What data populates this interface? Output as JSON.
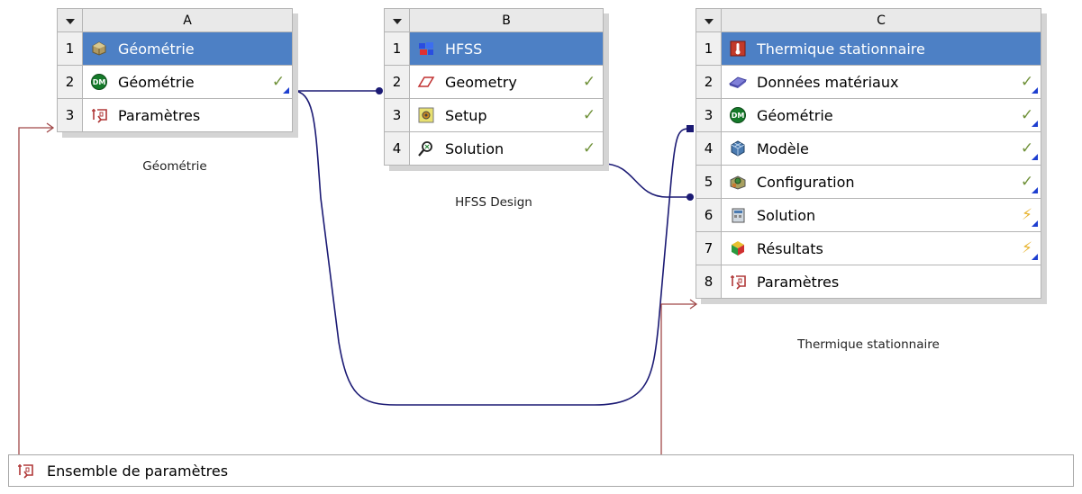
{
  "systems": {
    "a": {
      "letter": "A",
      "rows": [
        {
          "num": "1",
          "label": "Géométrie"
        },
        {
          "num": "2",
          "label": "Géométrie",
          "status": "✓"
        },
        {
          "num": "3",
          "label": "Paramètres"
        }
      ],
      "caption": "Géométrie"
    },
    "b": {
      "letter": "B",
      "rows": [
        {
          "num": "1",
          "label": "HFSS"
        },
        {
          "num": "2",
          "label": "Geometry",
          "status": "✓"
        },
        {
          "num": "3",
          "label": "Setup",
          "status": "✓"
        },
        {
          "num": "4",
          "label": "Solution",
          "status": "✓"
        }
      ],
      "caption": "HFSS Design"
    },
    "c": {
      "letter": "C",
      "rows": [
        {
          "num": "1",
          "label": "Thermique stationnaire"
        },
        {
          "num": "2",
          "label": "Données matériaux",
          "status": "✓"
        },
        {
          "num": "3",
          "label": "Géométrie",
          "status": "✓"
        },
        {
          "num": "4",
          "label": "Modèle",
          "status": "✓"
        },
        {
          "num": "5",
          "label": "Configuration",
          "status": "✓"
        },
        {
          "num": "6",
          "label": "Solution",
          "status": "⚡"
        },
        {
          "num": "7",
          "label": "Résultats",
          "status": "⚡"
        },
        {
          "num": "8",
          "label": "Paramètres"
        }
      ],
      "caption": "Thermique stationnaire"
    }
  },
  "parameter_set": {
    "label": "Ensemble de paramètres"
  },
  "colors": {
    "title_bg": "#4d80c5",
    "link_wire": "#1b1a74",
    "param_wire": "#a04848",
    "check": "#70923a",
    "bolt": "#e8b430"
  },
  "icons": {
    "a1": "geometry-box-icon",
    "a2": "design-modeler-icon",
    "a3": "parameters-icon",
    "b1": "hfss-icon",
    "b2": "geometry-eraser-icon",
    "b3": "setup-icon",
    "b4": "solution-icon",
    "c1": "thermal-icon",
    "c2": "engineering-data-icon",
    "c3": "design-modeler-icon",
    "c4": "model-icon",
    "c5": "setup-icon",
    "c6": "solution-icon",
    "c7": "results-icon",
    "c8": "parameters-icon"
  }
}
